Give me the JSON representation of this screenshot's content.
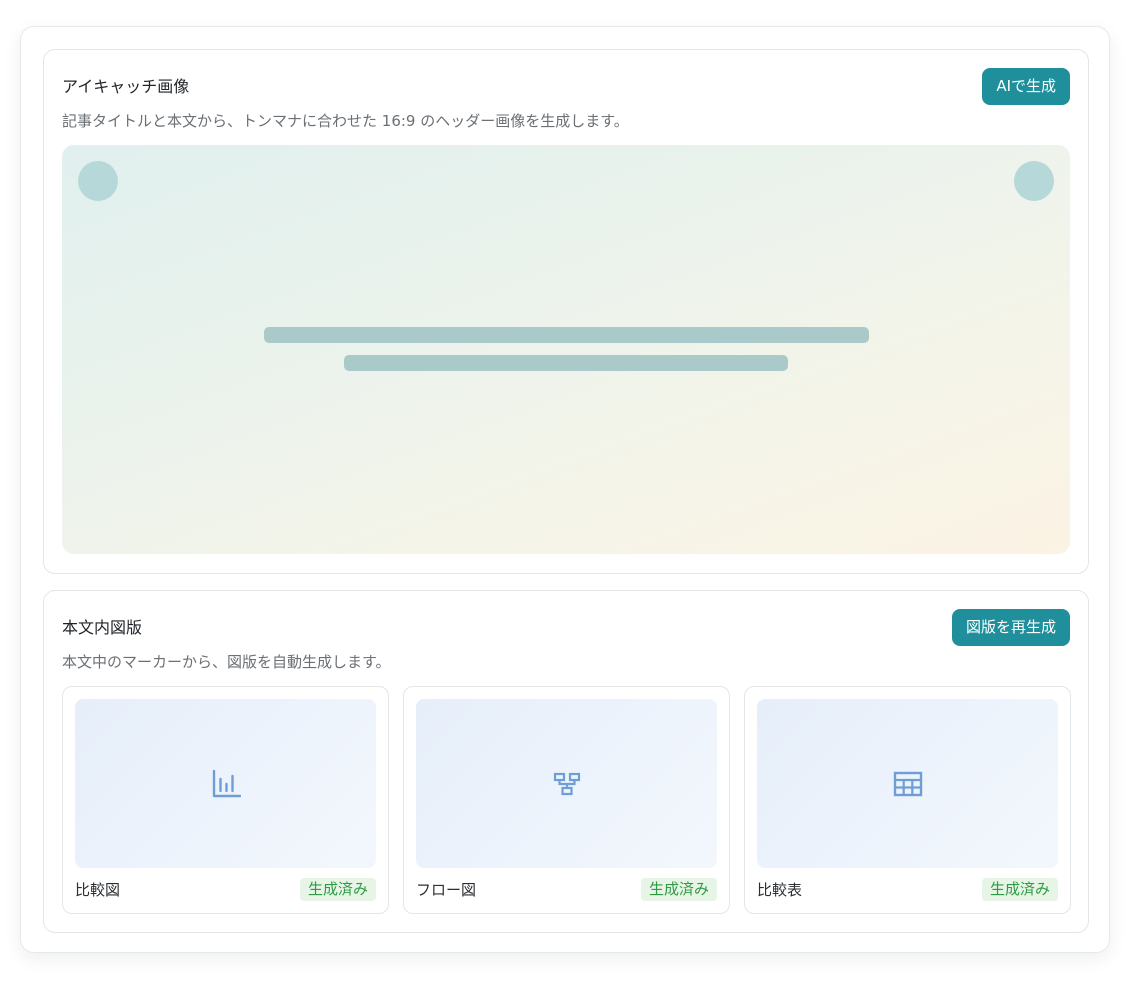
{
  "eyecatch": {
    "title": "アイキャッチ画像",
    "description": "記事タイトルと本文から、トンマナに合わせた 16:9 のヘッダー画像を生成します。",
    "generate_label": "AIで生成"
  },
  "figures": {
    "title": "本文内図版",
    "description": "本文中のマーカーから、図版を自動生成します。",
    "regenerate_label": "図版を再生成",
    "items": [
      {
        "name": "比較図",
        "status": "生成済み",
        "icon": "bar-chart-icon"
      },
      {
        "name": "フロー図",
        "status": "生成済み",
        "icon": "flowchart-icon"
      },
      {
        "name": "比較表",
        "status": "生成済み",
        "icon": "table-icon"
      }
    ]
  },
  "colors": {
    "accent": "#1e8f9b",
    "status_success": "#2f9a44",
    "status_success_bg": "#e6f5e6",
    "icon_blue": "#6f9ed6"
  }
}
